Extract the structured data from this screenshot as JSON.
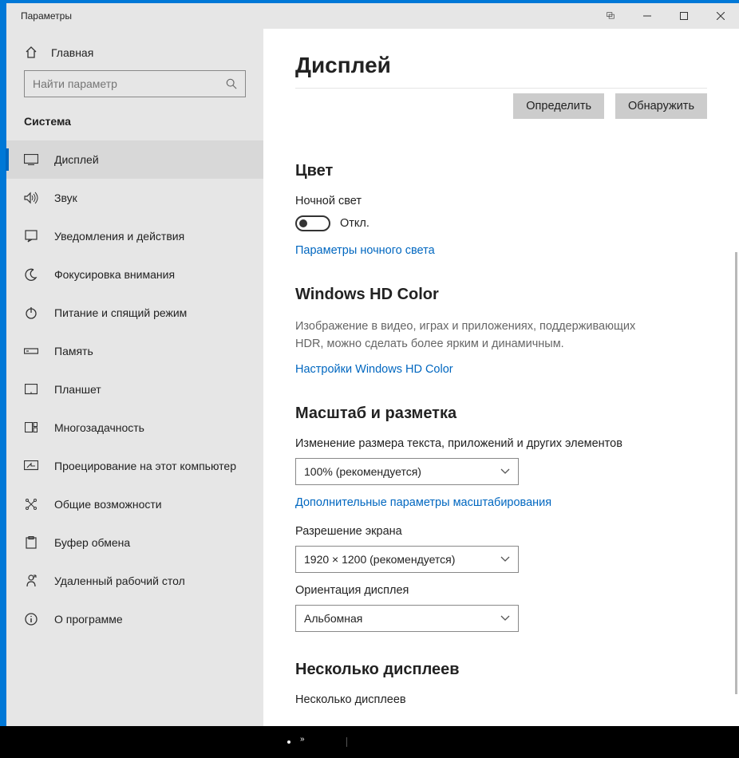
{
  "window": {
    "title": "Параметры"
  },
  "sidebar": {
    "home": "Главная",
    "search_placeholder": "Найти параметр",
    "section": "Система",
    "items": [
      {
        "label": "Дисплей"
      },
      {
        "label": "Звук"
      },
      {
        "label": "Уведомления и действия"
      },
      {
        "label": "Фокусировка внимания"
      },
      {
        "label": "Питание и спящий режим"
      },
      {
        "label": "Память"
      },
      {
        "label": "Планшет"
      },
      {
        "label": "Многозадачность"
      },
      {
        "label": "Проецирование на этот компьютер"
      },
      {
        "label": "Общие возможности"
      },
      {
        "label": "Буфер обмена"
      },
      {
        "label": "Удаленный рабочий стол"
      },
      {
        "label": "О программе"
      }
    ]
  },
  "main": {
    "title": "Дисплей",
    "identify_btn": "Определить",
    "detect_btn": "Обнаружить",
    "color": {
      "heading": "Цвет",
      "night_light_label": "Ночной свет",
      "toggle_state": "Откл.",
      "settings_link": "Параметры ночного света"
    },
    "hdr": {
      "heading": "Windows HD Color",
      "desc": "Изображение в видео, играх и приложениях, поддерживающих HDR, можно сделать более ярким и динамичным.",
      "link": "Настройки Windows HD Color"
    },
    "scale": {
      "heading": "Масштаб и разметка",
      "scale_label": "Изменение размера текста, приложений и других элементов",
      "scale_value": "100% (рекомендуется)",
      "advanced_link": "Дополнительные параметры масштабирования",
      "resolution_label": "Разрешение экрана",
      "resolution_value": "1920 × 1200 (рекомендуется)",
      "orientation_label": "Ориентация дисплея",
      "orientation_value": "Альбомная"
    },
    "multi": {
      "heading": "Несколько дисплеев",
      "label": "Несколько дисплеев"
    }
  }
}
